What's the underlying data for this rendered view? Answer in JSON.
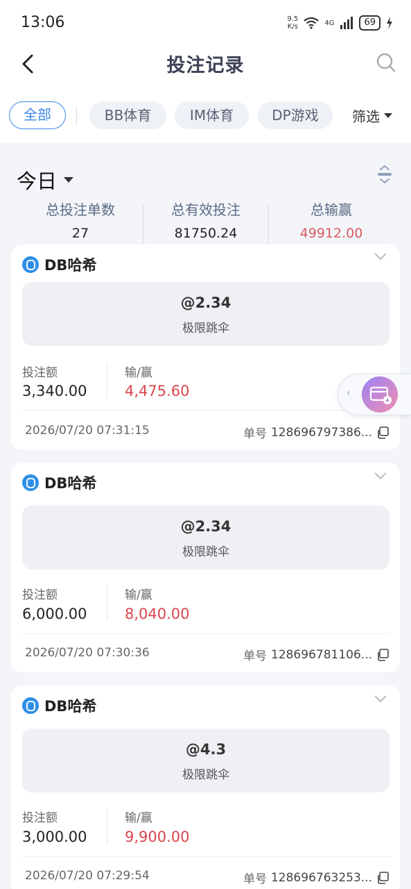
{
  "status_bar": {
    "time": "13:06",
    "speed_top": "9.5",
    "speed_bottom": "K/s",
    "network": "4G",
    "battery": "69"
  },
  "header": {
    "title": "投注记录"
  },
  "tabs": [
    {
      "label": "全部",
      "active": true
    },
    {
      "label": "BB体育"
    },
    {
      "label": "IM体育"
    },
    {
      "label": "DP游戏"
    }
  ],
  "filter_label": "筛选",
  "period": "今日",
  "summary": {
    "count_label": "总投注单数",
    "count_value": "27",
    "valid_label": "总有效投注",
    "valid_value": "81750.24",
    "win_label": "总输赢",
    "win_value": "49912.00"
  },
  "labels": {
    "bet_amount": "投注额",
    "win_loss": "输/赢",
    "order_prefix": "单号"
  },
  "bets": [
    {
      "platform": "DB哈希",
      "odds": "@2.34",
      "event": "极限跳伞",
      "bet": "3,340.00",
      "result": "4,475.60",
      "time": "2026/07/20 07:31:15",
      "order": "128696797386..."
    },
    {
      "platform": "DB哈希",
      "odds": "@2.34",
      "event": "极限跳伞",
      "bet": "6,000.00",
      "result": "8,040.00",
      "time": "2026/07/20 07:30:36",
      "order": "128696781106..."
    },
    {
      "platform": "DB哈希",
      "odds": "@4.3",
      "event": "极限跳伞",
      "bet": "3,000.00",
      "result": "9,900.00",
      "time": "2026/07/20 07:29:54",
      "order": "128696763253..."
    }
  ],
  "colors": {
    "accent": "#3d87e8",
    "win_red": "#d8464e",
    "summary_red": "#d85a62"
  }
}
